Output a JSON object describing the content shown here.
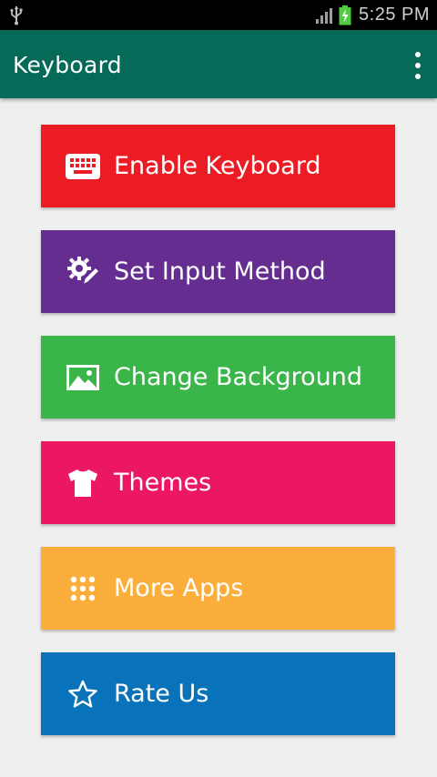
{
  "status_bar": {
    "time": "5:25 PM",
    "icons": [
      "usb-icon",
      "signal-icon",
      "battery-charging-icon"
    ]
  },
  "app_bar": {
    "title": "Keyboard",
    "overflow_icon": "more-vert-icon"
  },
  "menu": {
    "items": [
      {
        "label": "Enable Keyboard",
        "icon": "keyboard-icon",
        "color": "#ec1c24"
      },
      {
        "label": "Set Input Method",
        "icon": "gear-pencil-icon",
        "color": "#662d91"
      },
      {
        "label": "Change Background",
        "icon": "image-icon",
        "color": "#3ab54a"
      },
      {
        "label": "Themes",
        "icon": "tshirt-icon",
        "color": "#ec1763"
      },
      {
        "label": "More Apps",
        "icon": "apps-grid-icon",
        "color": "#fbae3b"
      },
      {
        "label": "Rate Us",
        "icon": "star-outline-icon",
        "color": "#0872bb"
      }
    ]
  },
  "colors": {
    "app_bar": "#056a58",
    "background": "#efefef",
    "status_bar": "#000000"
  }
}
